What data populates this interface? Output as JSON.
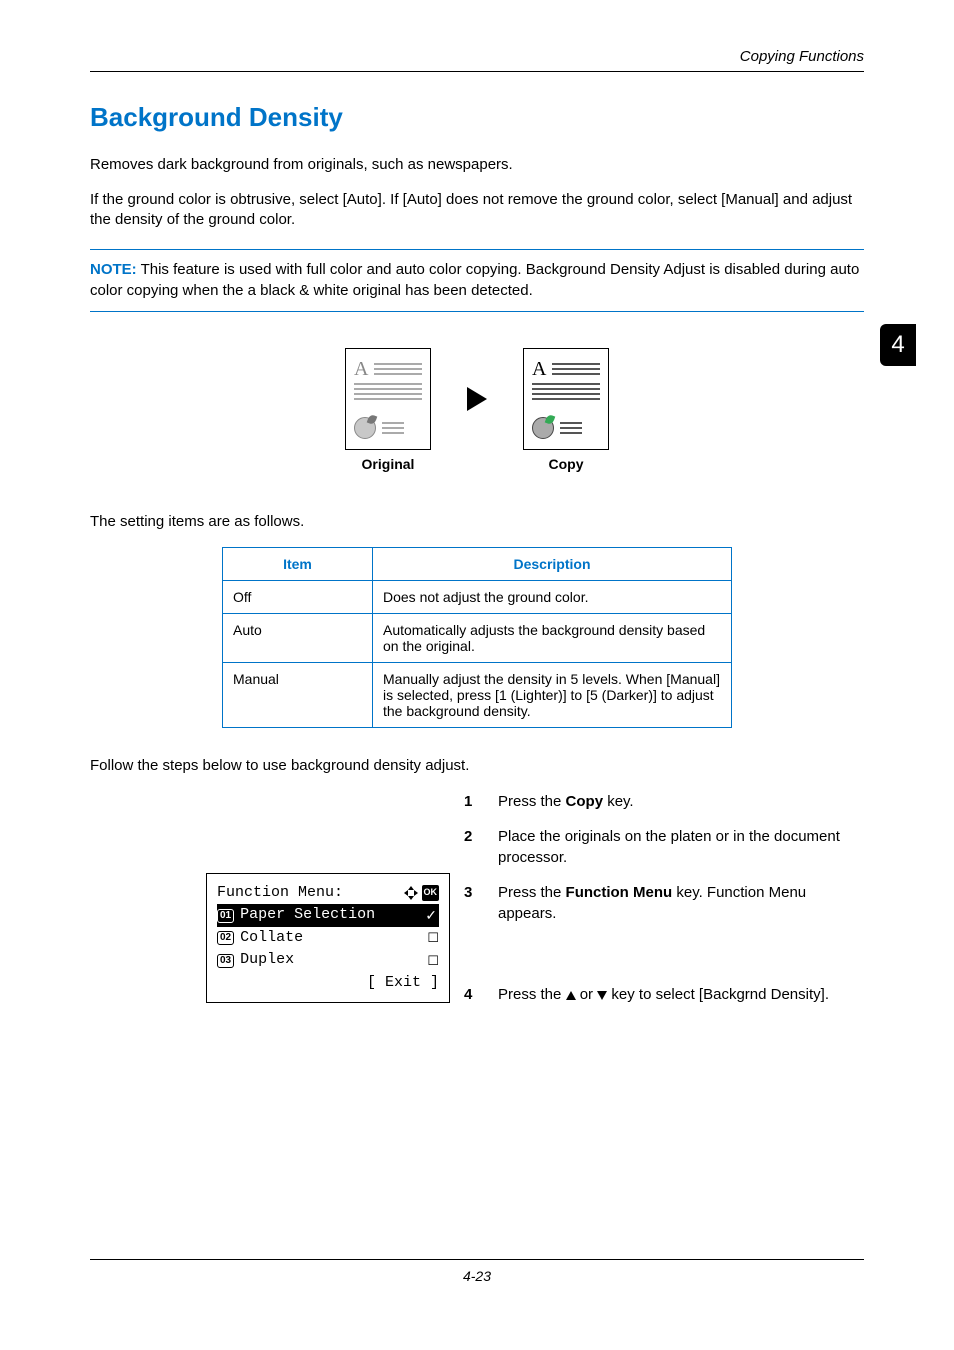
{
  "header": {
    "running": "Copying Functions"
  },
  "tab": {
    "number": "4"
  },
  "title": "Background Density",
  "paras": {
    "p1": "Removes dark background from originals, such as newspapers.",
    "p2": "If the ground color is obtrusive, select [Auto]. If [Auto] does not remove the ground color, select [Manual] and adjust the density of the ground color."
  },
  "note": {
    "label": "NOTE:",
    "text": " This feature is used with full color and auto color copying. Background Density Adjust is disabled during auto color copying when the a black & white original has been detected."
  },
  "illus": {
    "letter": "A",
    "original_caption": "Original",
    "copy_caption": "Copy"
  },
  "lead_in": "The setting items are as follows.",
  "table": {
    "head_item": "Item",
    "head_desc": "Description",
    "rows": [
      {
        "item": "Off",
        "desc": "Does not adjust the ground color."
      },
      {
        "item": "Auto",
        "desc": "Automatically adjusts the background density based on the original."
      },
      {
        "item": "Manual",
        "desc": "Manually adjust the density in 5 levels. When [Manual] is selected, press [1 (Lighter)] to [5 (Darker)] to adjust the background density."
      }
    ]
  },
  "follow": "Follow the steps below to use background density adjust.",
  "steps": {
    "s1_pre": "Press the ",
    "s1_key": "Copy",
    "s1_post": " key.",
    "s2": "Place the originals on the platen or in the document processor.",
    "s3_pre": "Press the ",
    "s3_key": "Function Menu",
    "s3_post": " key. Function Menu appears.",
    "s4_pre": "Press the ",
    "s4_mid": " or ",
    "s4_post": " key to select [Backgrnd Density]."
  },
  "lcd": {
    "title": "Function Menu:",
    "ok": "OK",
    "items": [
      {
        "num": "01",
        "label": "Paper Selection",
        "mark": "check"
      },
      {
        "num": "02",
        "label": "Collate",
        "mark": "box"
      },
      {
        "num": "03",
        "label": "Duplex",
        "mark": "box"
      }
    ],
    "softkey": "[  Exit  ]"
  },
  "footer": {
    "page": "4-23"
  }
}
